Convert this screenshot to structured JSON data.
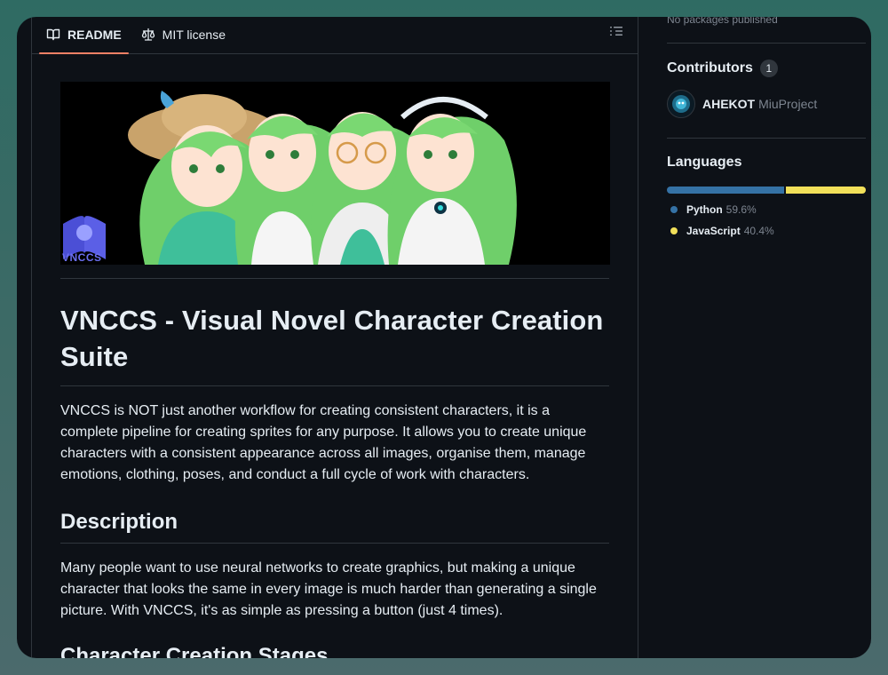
{
  "tabs": [
    {
      "label": "README",
      "icon": "book-icon",
      "active": true
    },
    {
      "label": "MIT license",
      "icon": "scale-icon",
      "active": false
    }
  ],
  "banner": {
    "logo_text": "VNCCS"
  },
  "readme": {
    "title": "VNCCS - Visual Novel Character Creation Suite",
    "intro": "VNCCS is NOT just another workflow for creating consistent characters, it is a complete pipeline for creating sprites for any purpose. It allows you to create unique characters with a consistent appearance across all images, organise them, manage emotions, clothing, poses, and conduct a full cycle of work with characters.",
    "description_heading": "Description",
    "description": "Many people want to use neural networks to create graphics, but making a unique character that looks the same in every image is much harder than generating a single picture. With VNCCS, it's as simple as pressing a button (just 4 times).",
    "stages_heading": "Character Creation Stages"
  },
  "sidebar": {
    "packages_text": "No packages published",
    "contributors": {
      "title": "Contributors",
      "count": "1",
      "people": [
        {
          "login": "AHEKOT",
          "name": "MiuProject"
        }
      ]
    },
    "languages": {
      "title": "Languages",
      "items": [
        {
          "name": "Python",
          "percent": "59.6%",
          "share": 59.6,
          "color": "#3572A5"
        },
        {
          "name": "JavaScript",
          "percent": "40.4%",
          "share": 40.4,
          "color": "#f1e05a"
        }
      ]
    }
  }
}
